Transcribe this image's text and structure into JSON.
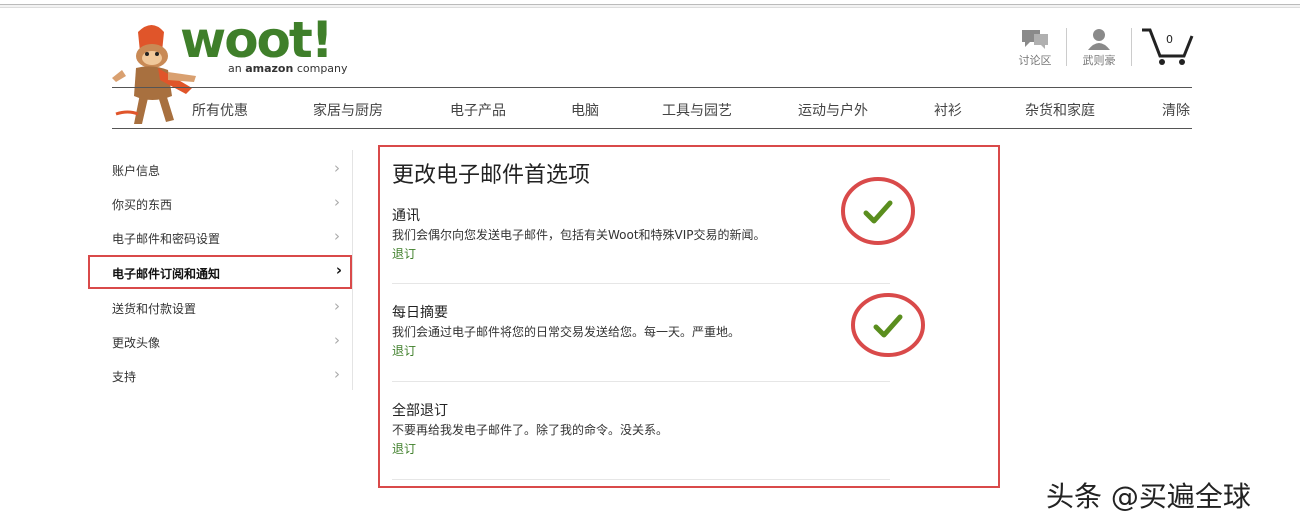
{
  "brand": {
    "name": "woot!",
    "sub_prefix": "an ",
    "sub_brand": "amazon",
    "sub_suffix": " company"
  },
  "header": {
    "forum_label": "讨论区",
    "user_label": "武则豪",
    "cart_count": "0"
  },
  "nav": [
    "所有优惠",
    "家居与厨房",
    "电子产品",
    "电脑",
    "工具与园艺",
    "运动与户外",
    "衬衫",
    "杂货和家庭",
    "清除"
  ],
  "sidebar": {
    "items": [
      {
        "label": "账户信息",
        "active": false
      },
      {
        "label": "你买的东西",
        "active": false
      },
      {
        "label": "电子邮件和密码设置",
        "active": false
      },
      {
        "label": "电子邮件订阅和通知",
        "active": true
      },
      {
        "label": "送货和付款设置",
        "active": false
      },
      {
        "label": "更改头像",
        "active": false
      },
      {
        "label": "支持",
        "active": false
      }
    ],
    "chevron": "›"
  },
  "main": {
    "title": "更改电子邮件首选项",
    "sections": [
      {
        "heading": "通讯",
        "desc": "我们会偶尔向您发送电子邮件，包括有关Woot和特殊VIP交易的新闻。",
        "link": "退订",
        "checked": true
      },
      {
        "heading": "每日摘要",
        "desc": "我们会通过电子邮件将您的日常交易发送给您。每一天。严重地。",
        "link": "退订",
        "checked": true
      },
      {
        "heading": "全部退订",
        "desc": "不要再给我发电子邮件了。除了我的命令。没关系。",
        "link": "退订",
        "checked": false
      }
    ]
  },
  "colors": {
    "brand_green": "#3f7f2a",
    "annotation_red": "#d94a4a"
  },
  "watermark": "头条 @买遍全球"
}
